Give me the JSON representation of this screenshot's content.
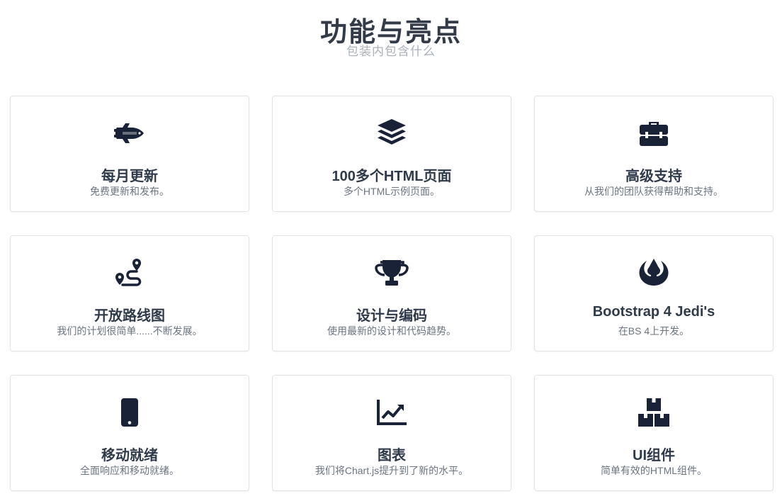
{
  "header": {
    "title": "功能与亮点",
    "subtitle": "包装内包含什么"
  },
  "features": [
    {
      "icon": "space-shuttle-icon",
      "title": "每月更新",
      "desc": "免费更新和发布。"
    },
    {
      "icon": "layers-icon",
      "title": "100多个HTML页面",
      "desc": "多个HTML示例页面。"
    },
    {
      "icon": "toolbox-icon",
      "title": "高级支持",
      "desc": "从我们的团队获得帮助和支持。"
    },
    {
      "icon": "route-icon",
      "title": "开放路线图",
      "desc": "我们的计划很简单......不断发展。"
    },
    {
      "icon": "trophy-icon",
      "title": "设计与编码",
      "desc": "使用最新的设计和代码趋势。"
    },
    {
      "icon": "jedi-order-icon",
      "title": "Bootstrap 4 Jedi's",
      "desc": "在BS 4上开发。"
    },
    {
      "icon": "mobile-icon",
      "title": "移动就绪",
      "desc": "全面响应和移动就绪。"
    },
    {
      "icon": "chart-line-icon",
      "title": "图表",
      "desc": "我们将Chart.js提升到了新的水平。"
    },
    {
      "icon": "boxes-icon",
      "title": "UI组件",
      "desc": "简单有效的HTML组件。"
    }
  ],
  "colors": {
    "icon": "#1a2238",
    "title": "#2f3a4a",
    "desc": "#6b7480",
    "border": "#dfe3e8"
  }
}
